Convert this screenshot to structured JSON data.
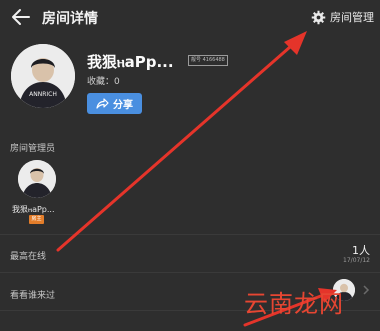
{
  "header": {
    "title": "房间详情",
    "manage_label": "房间管理"
  },
  "room": {
    "name": "我狠ⲏaPp...",
    "id_text": "靓号 4166488",
    "collect_text": "收藏：0",
    "share_label": "分享",
    "jersey_text": "ANNRICH"
  },
  "admins": {
    "section_label": "房间管理员",
    "items": [
      {
        "name": "我狠ⲏaPp...",
        "badge": "房主"
      }
    ]
  },
  "stats": {
    "online_label": "最高在线",
    "online_count": "1人",
    "online_date": "17/07/12",
    "visitors_label": "看看谁来过"
  },
  "watermark": "云南龙网",
  "colors": {
    "background": "#2e2e2e",
    "share": "#4a8fe0",
    "badge": "#e37d2a",
    "arrow": "#e5342a"
  }
}
